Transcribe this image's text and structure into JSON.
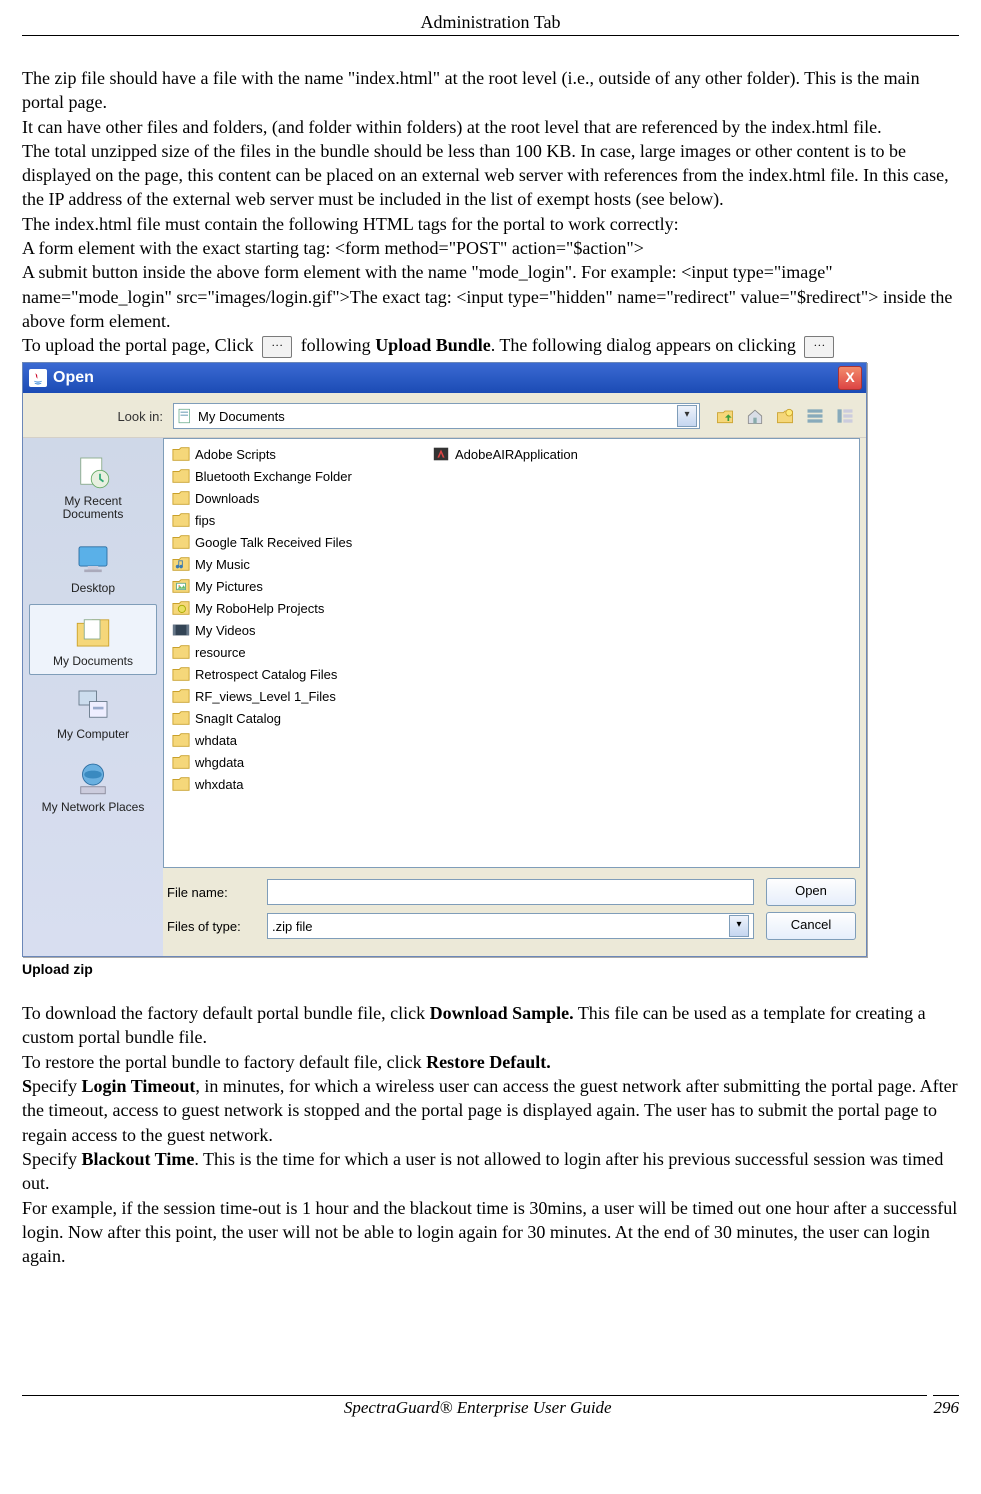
{
  "header": {
    "title": "Administration Tab"
  },
  "intro": {
    "p1": " The zip file should have a file with the name \"index.html\" at the root level (i.e., outside of any other folder). This is the main portal page.",
    "p2": "It can have other files and folders, (and folder within folders) at the root level that are referenced by the index.html file.",
    "p3": "The total unzipped size of the files in the bundle should be less than 100 KB.  In case, large images or other content is to be displayed on the page, this content can be placed on an external web server with references from the index.html file.  In this case, the IP address of the external web server must be included in the list of exempt hosts (see below).",
    "p4": "The index.html file must contain the following HTML tags for the portal to work correctly:",
    "p5": "A form element with the exact starting tag: <form method=\"POST\" action=\"$action\">",
    "p6": "A submit button inside the above form element with the name \"mode_login\". For example: <input type=\"image\" name=\"mode_login\" src=\"images/login.gif\">The exact tag: <input type=\"hidden\" name=\"redirect\" value=\"$redirect\"> inside the above form element.",
    "upload_pre": "To upload the portal page, Click ",
    "upload_mid": "  following ",
    "upload_bold": "Upload Bundle",
    "upload_post": ". The following dialog appears on clicking "
  },
  "dialog": {
    "title": "Open",
    "lookin_label": "Look in:",
    "lookin_value": "My Documents",
    "places": [
      {
        "label": "My Recent Documents",
        "icon": "recent"
      },
      {
        "label": "Desktop",
        "icon": "desktop"
      },
      {
        "label": "My Documents",
        "icon": "documents",
        "selected": true
      },
      {
        "label": "My Computer",
        "icon": "computer"
      },
      {
        "label": "My Network Places",
        "icon": "network"
      }
    ],
    "files_col1": [
      {
        "label": "Adobe Scripts",
        "type": "folder"
      },
      {
        "label": "Bluetooth Exchange Folder",
        "type": "folder"
      },
      {
        "label": "Downloads",
        "type": "folder"
      },
      {
        "label": "fips",
        "type": "folder"
      },
      {
        "label": "Google Talk Received Files",
        "type": "folder"
      },
      {
        "label": "My Music",
        "type": "music"
      },
      {
        "label": "My Pictures",
        "type": "pictures"
      },
      {
        "label": "My RoboHelp Projects",
        "type": "robohelp"
      },
      {
        "label": "My Videos",
        "type": "video"
      },
      {
        "label": "resource",
        "type": "folder"
      },
      {
        "label": "Retrospect Catalog Files",
        "type": "folder"
      },
      {
        "label": "RF_views_Level 1_Files",
        "type": "folder"
      },
      {
        "label": "SnagIt Catalog",
        "type": "folder"
      },
      {
        "label": "whdata",
        "type": "folder"
      },
      {
        "label": "whgdata",
        "type": "folder"
      },
      {
        "label": "whxdata",
        "type": "folder"
      }
    ],
    "files_col2": [
      {
        "label": "AdobeAIRApplication",
        "type": "air"
      }
    ],
    "filename_label": "File name:",
    "filename_value": "",
    "filetype_label": "Files of type:",
    "filetype_value": ".zip file",
    "open_btn": "Open",
    "cancel_btn": "Cancel"
  },
  "caption": "Upload zip",
  "after": {
    "p1a": "To download the factory default portal bundle file, click ",
    "p1b": "Download Sample.",
    "p1c": " This file can be used as a template for creating a custom portal bundle file.",
    "p2a": "To restore the portal bundle to factory default file, click ",
    "p2b": "Restore Default.",
    "p3a": "S",
    "p3b": "pecify ",
    "p3c": "Login Timeout",
    "p3d": ", in minutes, for which a wireless user can access the guest network after submitting the portal page. After the timeout, access to guest network is stopped and the portal page is displayed again. The user has to submit the portal page to regain access to the guest network.",
    "p4a": "Specify ",
    "p4b": "Blackout Time",
    "p4c": ". This is the time for which a user is not allowed to login after his previous successful session was timed out.",
    "p5": "For example,  if the session time-out is 1 hour and the blackout time is 30mins, a user will be timed out one hour after a successful login. Now after this point, the user will not be able to login again for 30 minutes. At the end of  30 minutes, the user can login again."
  },
  "footer": {
    "title": "SpectraGuard®  Enterprise User Guide",
    "page": "296"
  }
}
